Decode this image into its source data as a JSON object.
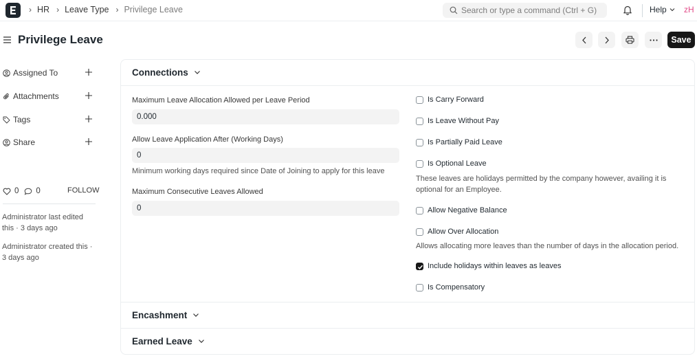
{
  "breadcrumbs": [
    {
      "label": "HR"
    },
    {
      "label": "Leave Type"
    },
    {
      "label": "Privilege Leave"
    }
  ],
  "search": {
    "placeholder": "Search or type a command (Ctrl + G)"
  },
  "help_label": "Help",
  "user_initials": "zH",
  "page_title": "Privilege Leave",
  "save_label": "Save",
  "sidebar": {
    "items": [
      {
        "label": "Assigned To",
        "icon": "assign-user-icon"
      },
      {
        "label": "Attachments",
        "icon": "paperclip-icon"
      },
      {
        "label": "Tags",
        "icon": "tag-icon"
      },
      {
        "label": "Share",
        "icon": "share-user-icon"
      }
    ],
    "likes": "0",
    "comments": "0",
    "follow_label": "FOLLOW",
    "activity": [
      "Administrator last edited this · 3 days ago",
      "Administrator created this · 3 days ago"
    ]
  },
  "sections": {
    "connections": "Connections",
    "encashment": "Encashment",
    "earned_leave": "Earned Leave"
  },
  "fields": {
    "max_allocation": {
      "label": "Maximum Leave Allocation Allowed per Leave Period",
      "value": "0.000"
    },
    "allow_after": {
      "label": "Allow Leave Application After (Working Days)",
      "value": "0",
      "description": "Minimum working days required since Date of Joining to apply for this leave"
    },
    "max_consecutive": {
      "label": "Maximum Consecutive Leaves Allowed",
      "value": "0"
    }
  },
  "checks": [
    {
      "label": "Is Carry Forward",
      "checked": false
    },
    {
      "label": "Is Leave Without Pay",
      "checked": false
    },
    {
      "label": "Is Partially Paid Leave",
      "checked": false
    },
    {
      "label": "Is Optional Leave",
      "checked": false
    },
    {
      "label": "Allow Negative Balance",
      "checked": false
    },
    {
      "label": "Allow Over Allocation",
      "checked": false
    },
    {
      "label": "Include holidays within leaves as leaves",
      "checked": true
    },
    {
      "label": "Is Compensatory",
      "checked": false
    }
  ],
  "check_descriptions": {
    "optional_leave": "These leaves are holidays permitted by the company however, availing it is optional for an Employee.",
    "over_allocation": "Allows allocating more leaves than the number of days in the allocation period."
  },
  "colors": {
    "primary": "#171717",
    "user_initials": "#e24c89",
    "input_bg": "#f3f3f3"
  }
}
